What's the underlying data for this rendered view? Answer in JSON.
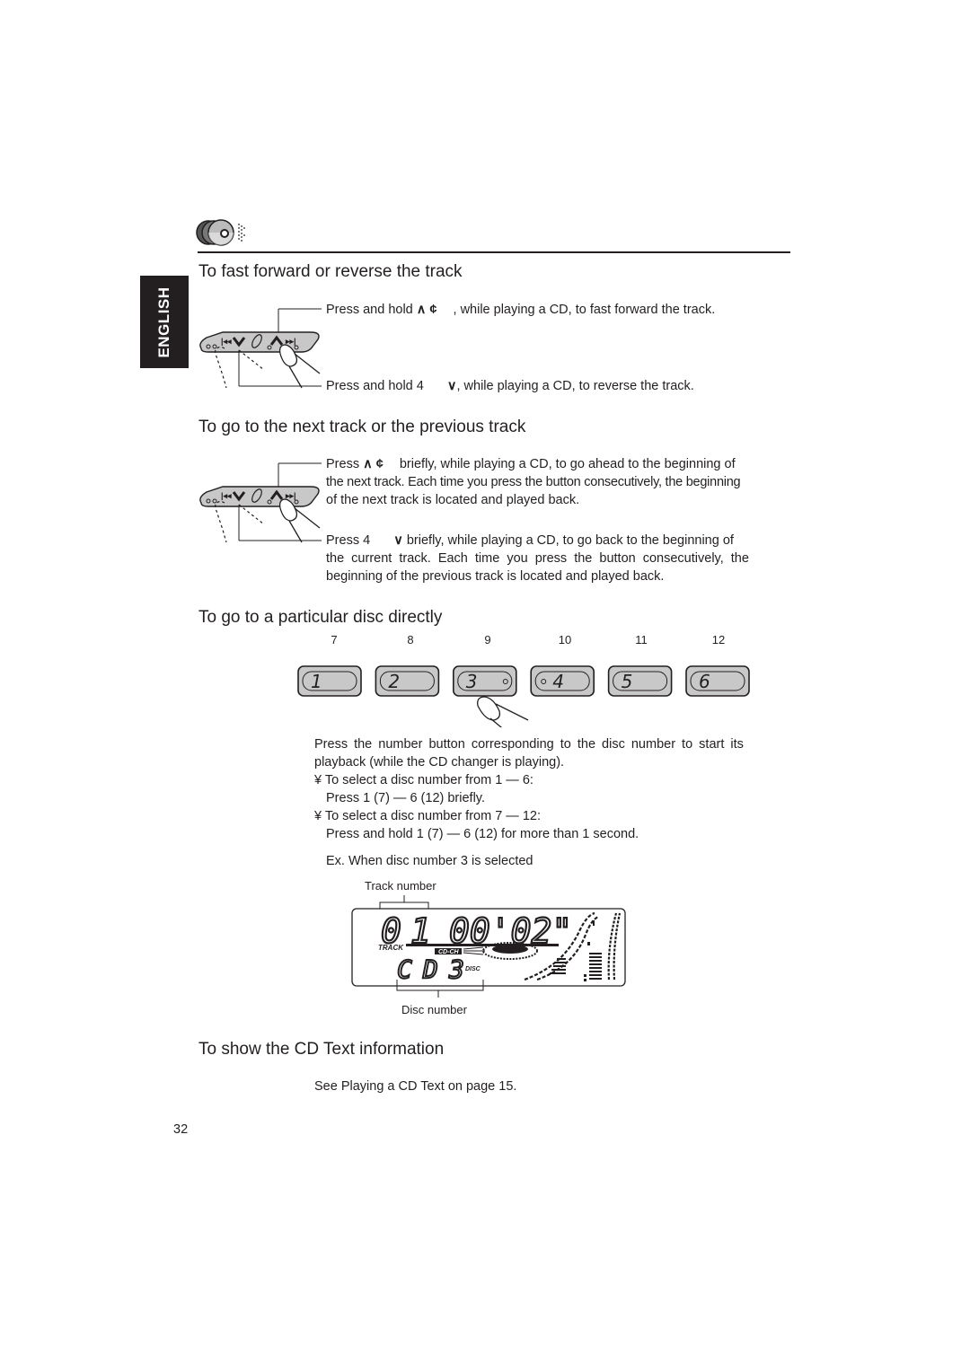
{
  "page": {
    "side_tab": "ENGLISH",
    "page_number": "32",
    "header_icon": "cd-changer-icon"
  },
  "sections": {
    "ff_rew": {
      "title": "To fast forward or reverse the track",
      "fwd_prefix": "Press and hold",
      "fwd_symbols": "∧ ¢",
      "fwd_suffix": ", while playing a CD, to fast forward the track.",
      "rev_prefix": "Press and hold 4",
      "rev_symbol": "∨",
      "rev_suffix": ", while playing a CD, to reverse the track."
    },
    "next_prev": {
      "title": "To go to the next track or the previous track",
      "next_prefix": "Press",
      "next_symbols": "∧ ¢",
      "next_line1_suffix": "briefly, while playing a CD, to go ahead to the beginning of",
      "next_line2": "the next track. Each time you press the button consecutively, the beginning",
      "next_line3": "of the next track is located and played back.",
      "prev_prefix": "Press 4",
      "prev_symbol": "∨",
      "prev_line1_suffix": "briefly, while playing a CD, to go back to the beginning of",
      "prev_line2": "the current track. Each time you press the button consecutively, the",
      "prev_line3": "beginning of the previous track is located and played back."
    },
    "disc": {
      "title": "To go to a particular disc directly",
      "alt_numbers": [
        "7",
        "8",
        "9",
        "10",
        "11",
        "12"
      ],
      "buttons": [
        "1",
        "2",
        "3",
        "4",
        "5",
        "6"
      ],
      "para_line1": "Press the number button corresponding to the disc number to start its",
      "para_line2": "playback (while the CD changer is playing).",
      "bullet1": "¥  To select a disc number from 1 — 6:",
      "bullet1_sub": "Press 1 (7) — 6 (12) briefly.",
      "bullet2": "¥  To select a disc number from 7 — 12:",
      "bullet2_sub": "Press and hold 1 (7) — 6 (12) for more than 1 second.",
      "example": "Ex. When disc number 3 is selected",
      "lcd": {
        "track_label": "Track number",
        "disc_label": "Disc number",
        "track_digits": "01",
        "time": "00'02\"",
        "track_tag": "TRACK",
        "cdch_tag": "CD-CH",
        "disc_text": "CD",
        "disc_digit": "3",
        "disc_tag": "DISC"
      }
    },
    "cdtext": {
      "title": "To show the CD Text information",
      "body": "See  Playing a CD Text  on page 15."
    }
  }
}
